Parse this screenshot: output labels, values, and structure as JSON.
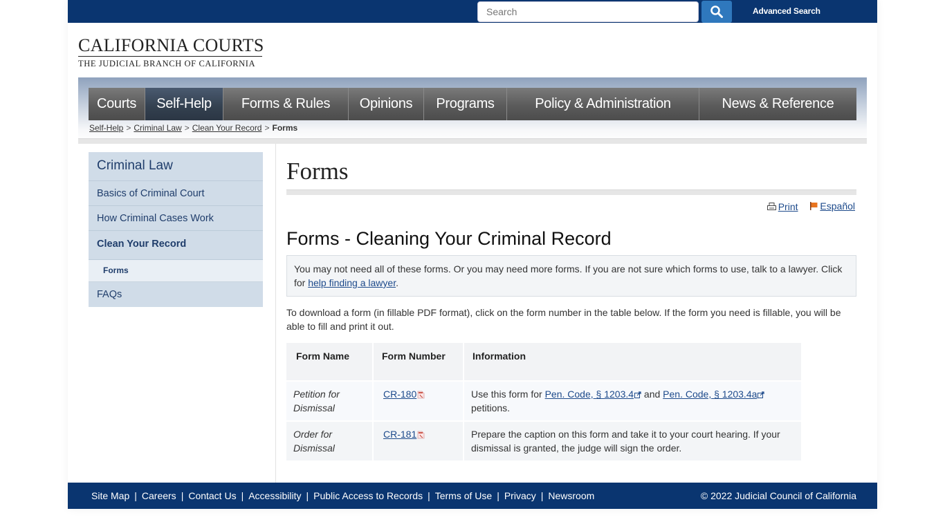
{
  "header": {
    "search_placeholder": "Search",
    "search_button_icon": "search-icon",
    "advanced_search": "Advanced Search",
    "logo_title": "CALIFORNIA COURTS",
    "logo_subtitle": "THE JUDICIAL BRANCH OF CALIFORNIA"
  },
  "nav": {
    "items": [
      {
        "label": "Courts",
        "active": false
      },
      {
        "label": "Self-Help",
        "active": true
      },
      {
        "label": "Forms & Rules",
        "active": false
      },
      {
        "label": "Opinions",
        "active": false
      },
      {
        "label": "Programs",
        "active": false
      },
      {
        "label": "Policy & Administration",
        "active": false
      },
      {
        "label": "News & Reference",
        "active": false
      }
    ]
  },
  "breadcrumb": {
    "items": [
      "Self-Help",
      "Criminal Law",
      "Clean Your Record"
    ],
    "separator": ">",
    "current": "Forms"
  },
  "sidebar": {
    "heading": "Criminal Law",
    "items": [
      {
        "label": "Basics of Criminal Court"
      },
      {
        "label": "How Criminal Cases Work"
      },
      {
        "label": "Clean Your Record",
        "active": true
      },
      {
        "label": "Forms",
        "sub": true,
        "current": true
      },
      {
        "label": "FAQs"
      }
    ]
  },
  "main": {
    "page_title": "Forms",
    "tools": {
      "print": "Print",
      "print_icon": "printer-icon",
      "espanol": "Español",
      "espanol_icon": "flag-icon"
    },
    "section_title": "Forms - Cleaning Your Criminal Record",
    "notice_text": "You may not need all of these forms. Or you may need more forms. If you are not sure which forms to use, talk to a lawyer. Click for ",
    "notice_link": "help finding a lawyer",
    "notice_end": ".",
    "intro": "To download a form (in fillable PDF format), click on the form number in the table below. If the form you need is fillable, you will be able to fill and print it out.",
    "table": {
      "headers": [
        "Form Name",
        "Form Number",
        "Information"
      ],
      "rows": [
        {
          "form_name": "Petition for Dismissal",
          "form_number": "CR-180",
          "info_prefix": "Use this form for ",
          "link1": "Pen. Code, § 1203.4",
          "info_mid": " and ",
          "link2": "Pen. Code, § 1203.4a",
          "info_suffix": " petitions."
        },
        {
          "form_name": "Order for Dismissal",
          "form_number": "CR-181",
          "info": "Prepare the caption on this form and take it to your court hearing. If your dismissal is granted, the judge will sign the order."
        }
      ]
    }
  },
  "footer": {
    "links": [
      "Site Map",
      "Careers",
      "Contact Us",
      "Accessibility",
      "Public Access to Records",
      "Terms of Use",
      "Privacy",
      "Newsroom"
    ],
    "separator": "|",
    "copyright": "© 2022 Judicial Council of California"
  },
  "colors": {
    "brand_navy": "#0a3570",
    "search_button": "#2f78bd",
    "sidebar_bg": "#d0dce8",
    "link": "#1d4a8b",
    "nav_active": "#33404f",
    "nav_default": "#5b5b5b"
  }
}
